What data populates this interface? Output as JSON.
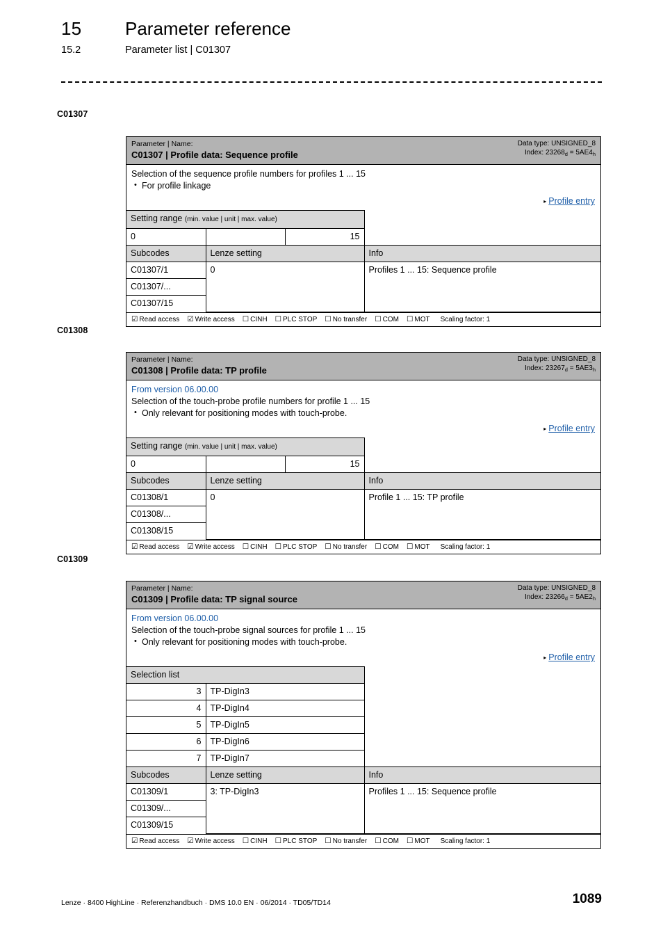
{
  "header": {
    "chapter_number": "15",
    "chapter_title": "Parameter reference",
    "section_number": "15.2",
    "section_title": "Parameter list | C01307"
  },
  "footer": {
    "text": "Lenze · 8400 HighLine · Referenzhandbuch · DMS 10.0 EN · 06/2014 · TD05/TD14",
    "page_number": "1089"
  },
  "common": {
    "param_name_label": "Parameter | Name:",
    "setting_range_label": "Setting range",
    "setting_range_note": "(min. value | unit | max. value)",
    "selection_list_label": "Selection list",
    "subcodes_label": "Subcodes",
    "lenze_setting_label": "Lenze setting",
    "info_label": "Info",
    "profile_entry_link": "Profile entry",
    "link_arrow": "▸",
    "checked_box": "☑",
    "unchecked_box": "☐",
    "access": {
      "read": "Read access",
      "write": "Write access",
      "cinh": "CINH",
      "plc_stop": "PLC STOP",
      "no_transfer": "No transfer",
      "com": "COM",
      "mot": "MOT",
      "scaling": "Scaling factor: 1"
    }
  },
  "blocks": [
    {
      "margin_label": "C01307",
      "title": "C01307 | Profile data: Sequence profile",
      "data_type": "Data type: UNSIGNED_8",
      "index_prefix": "Index: 23268",
      "index_sub1": "d",
      "index_mid": " = 5AE4",
      "index_sub2": "h",
      "version_note": "",
      "description": "Selection of the sequence profile numbers for profiles 1 ... 15",
      "bullet": "For profile linkage",
      "setting_min": "0",
      "setting_unit": "",
      "setting_max": "15",
      "subcodes": [
        {
          "code": "C01307/1",
          "setting": "0",
          "info": "Profiles 1 ... 15: Sequence profile"
        },
        {
          "code": "C01307/...",
          "setting": "",
          "info": ""
        },
        {
          "code": "C01307/15",
          "setting": "",
          "info": ""
        }
      ]
    },
    {
      "margin_label": "C01308",
      "title": "C01308 | Profile data: TP profile",
      "data_type": "Data type: UNSIGNED_8",
      "index_prefix": "Index: 23267",
      "index_sub1": "d",
      "index_mid": " = 5AE3",
      "index_sub2": "h",
      "version_note": "From version 06.00.00",
      "description": "Selection of the touch-probe profile numbers for profile 1 ... 15",
      "bullet": "Only relevant for positioning modes with touch-probe.",
      "setting_min": "0",
      "setting_unit": "",
      "setting_max": "15",
      "subcodes": [
        {
          "code": "C01308/1",
          "setting": "0",
          "info": "Profile 1 ... 15: TP profile"
        },
        {
          "code": "C01308/...",
          "setting": "",
          "info": ""
        },
        {
          "code": "C01308/15",
          "setting": "",
          "info": ""
        }
      ]
    },
    {
      "margin_label": "C01309",
      "title": "C01309 | Profile data: TP signal source",
      "data_type": "Data type: UNSIGNED_8",
      "index_prefix": "Index: 23266",
      "index_sub1": "d",
      "index_mid": " = 5AE2",
      "index_sub2": "h",
      "version_note": "From version 06.00.00",
      "description": "Selection of the touch-probe signal sources for profile 1 ... 15",
      "bullet": "Only relevant for positioning modes with touch-probe.",
      "selection_list": [
        {
          "value": "3",
          "label": "TP-DigIn3"
        },
        {
          "value": "4",
          "label": "TP-DigIn4"
        },
        {
          "value": "5",
          "label": "TP-DigIn5"
        },
        {
          "value": "6",
          "label": "TP-DigIn6"
        },
        {
          "value": "7",
          "label": "TP-DigIn7"
        }
      ],
      "subcodes": [
        {
          "code": "C01309/1",
          "setting": "3: TP-DigIn3",
          "info": "Profiles 1 ... 15: Sequence profile"
        },
        {
          "code": "C01309/...",
          "setting": "",
          "info": ""
        },
        {
          "code": "C01309/15",
          "setting": "",
          "info": ""
        }
      ]
    }
  ]
}
